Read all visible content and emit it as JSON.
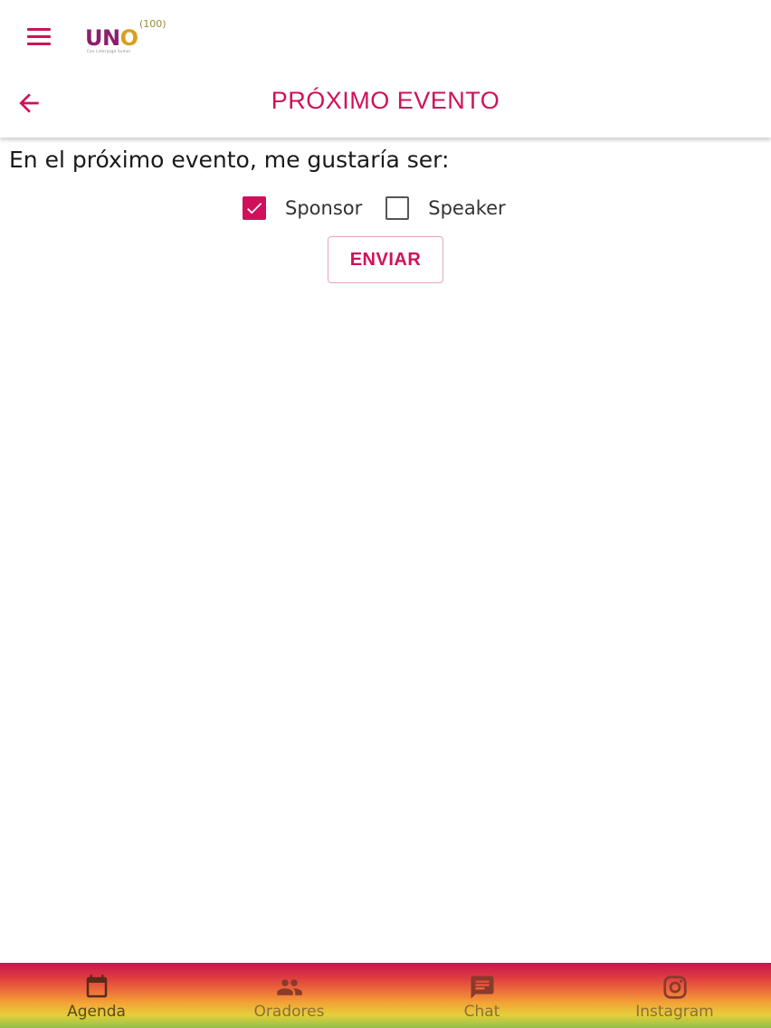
{
  "app": {
    "logo_text_main": "UN",
    "logo_text_o": "O",
    "logo_superscript": "(100)",
    "logo_tagline": "Con Liderazgo Sumar"
  },
  "header": {
    "title": "PRÓXIMO EVENTO"
  },
  "form": {
    "question": "En el próximo evento, me gustaría ser:",
    "options": [
      {
        "label": "Sponsor",
        "checked": true
      },
      {
        "label": "Speaker",
        "checked": false
      }
    ],
    "submit_label": "ENVIAR"
  },
  "bottom_nav": {
    "items": [
      {
        "label": "Agenda",
        "icon": "calendar-icon",
        "active": true
      },
      {
        "label": "Oradores",
        "icon": "people-icon",
        "active": false
      },
      {
        "label": "Chat",
        "icon": "chat-icon",
        "active": false
      },
      {
        "label": "Instagram",
        "icon": "instagram-icon",
        "active": false
      }
    ]
  },
  "colors": {
    "accent": "#d0105a",
    "logo_purple": "#8b1e6e",
    "logo_gold": "#d9a01e"
  }
}
